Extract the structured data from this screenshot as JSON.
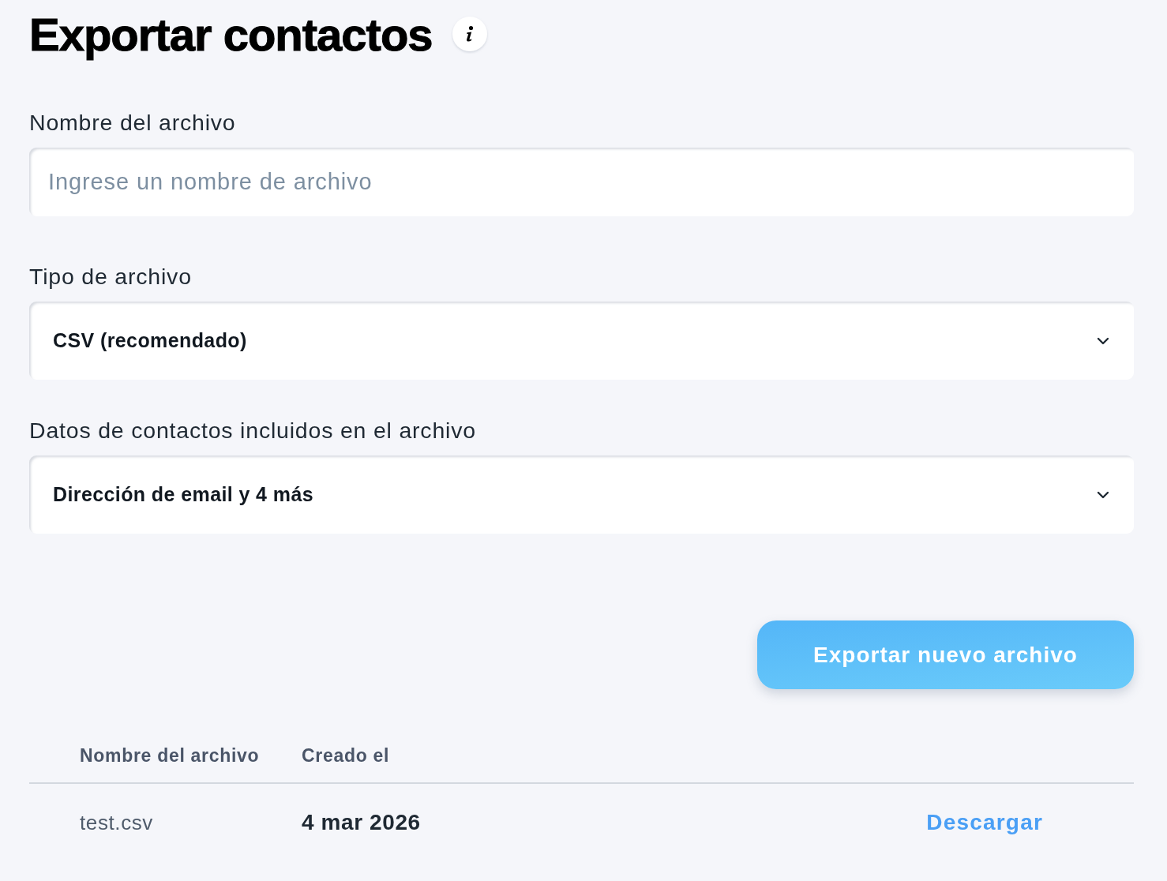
{
  "header": {
    "title": "Exportar contactos"
  },
  "form": {
    "fields": [
      {
        "kind": "text",
        "label": "Nombre del archivo",
        "placeholder": "Ingrese un nombre de archivo"
      },
      {
        "kind": "select",
        "label": "Tipo de archivo",
        "value": "CSV (recomendado)"
      },
      {
        "kind": "select",
        "label": "Datos de contactos incluidos en el archivo",
        "value": "Dirección de email y 4 más"
      }
    ]
  },
  "export_button": {
    "label": "Exportar nuevo archivo"
  },
  "table": {
    "columns": [
      "Nombre del archivo",
      "Creado el"
    ],
    "rows": [
      {
        "cells": [
          "test.csv",
          "4 mar 2026"
        ],
        "action": "Descargar"
      }
    ]
  }
}
